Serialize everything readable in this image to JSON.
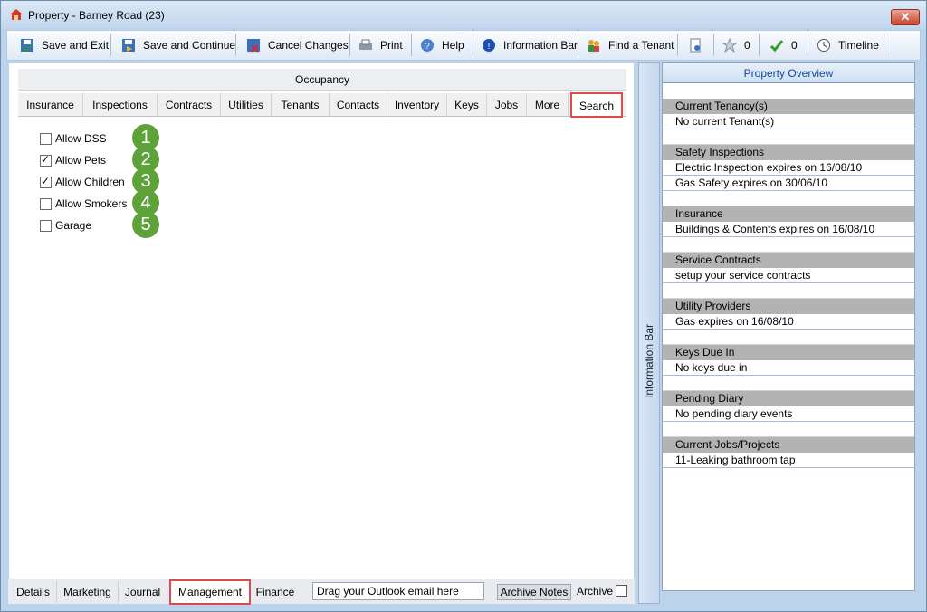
{
  "window": {
    "title": "Property  - Barney Road (23)",
    "close_label": "✕"
  },
  "toolbar": {
    "save_exit": "Save and Exit",
    "save_continue": "Save and Continue",
    "cancel_changes": "Cancel Changes",
    "print": "Print",
    "help": "Help",
    "information_bar": "Information Bar",
    "find_tenant": "Find a Tenant",
    "star_count": "0",
    "check_count": "0",
    "timeline": "Timeline"
  },
  "occupancy": {
    "header": "Occupancy"
  },
  "tabs": [
    {
      "label": "Insurance"
    },
    {
      "label": "Inspections"
    },
    {
      "label": "Contracts"
    },
    {
      "label": "Utilities"
    },
    {
      "label": "Tenants"
    },
    {
      "label": "Contacts"
    },
    {
      "label": "Inventory"
    },
    {
      "label": "Keys"
    },
    {
      "label": "Jobs"
    },
    {
      "label": "More"
    },
    {
      "label": "Search",
      "active": true
    }
  ],
  "options": [
    {
      "label": "Allow DSS",
      "checked": false,
      "badge": "1"
    },
    {
      "label": "Allow Pets",
      "checked": true,
      "badge": "2"
    },
    {
      "label": "Allow Children",
      "checked": true,
      "badge": "3"
    },
    {
      "label": "Allow Smokers",
      "checked": false,
      "badge": "4"
    },
    {
      "label": "Garage",
      "checked": false,
      "badge": "5"
    }
  ],
  "bottom_tabs": [
    {
      "label": "Details"
    },
    {
      "label": "Marketing"
    },
    {
      "label": "Journal"
    },
    {
      "label": "Management",
      "active": true
    },
    {
      "label": "Finance"
    }
  ],
  "bottom_bar": {
    "drag_text": "Drag your Outlook email here",
    "archive_notes": "Archive Notes",
    "archive_label": "Archive"
  },
  "info_bar": {
    "label": "Information Bar"
  },
  "overview": {
    "header": "Property Overview",
    "sections": [
      {
        "title": "Current Tenancy(s)",
        "rows": [
          "No current Tenant(s)"
        ]
      },
      {
        "title": "Safety Inspections",
        "rows": [
          "Electric Inspection expires on 16/08/10",
          "Gas Safety expires on 30/06/10"
        ]
      },
      {
        "title": "Insurance",
        "rows": [
          "Buildings & Contents expires on 16/08/10"
        ]
      },
      {
        "title": "Service Contracts",
        "rows": [
          "setup your service contracts"
        ]
      },
      {
        "title": "Utility Providers",
        "rows": [
          "Gas expires on 16/08/10"
        ]
      },
      {
        "title": "Keys Due In",
        "rows": [
          "No keys due in"
        ]
      },
      {
        "title": "Pending Diary",
        "rows": [
          "No pending diary events"
        ]
      },
      {
        "title": "Current Jobs/Projects",
        "rows": [
          "11-Leaking bathroom tap"
        ]
      }
    ]
  },
  "colors": {
    "badge": "#5ea33a",
    "highlight": "#e04a4a",
    "section_gray": "#b3b3b3",
    "accent_blue": "#1646a0"
  }
}
